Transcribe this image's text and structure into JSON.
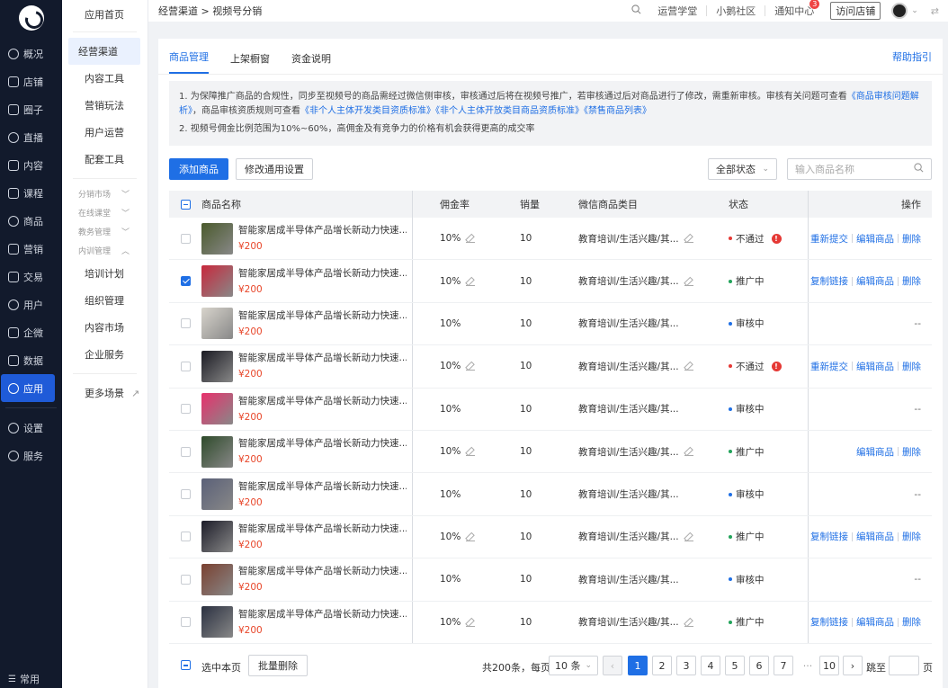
{
  "rail": {
    "items": [
      {
        "label": "概况",
        "icon": "pie-chart-icon"
      },
      {
        "label": "店铺",
        "icon": "store-icon"
      },
      {
        "label": "圈子",
        "icon": "group-icon"
      },
      {
        "label": "直播",
        "icon": "live-icon"
      },
      {
        "label": "内容",
        "icon": "content-icon"
      },
      {
        "label": "课程",
        "icon": "course-icon"
      },
      {
        "label": "商品",
        "icon": "goods-icon"
      },
      {
        "label": "营销",
        "icon": "marketing-icon"
      },
      {
        "label": "交易",
        "icon": "trade-icon"
      },
      {
        "label": "用户",
        "icon": "user-icon"
      },
      {
        "label": "企微",
        "icon": "wecom-icon"
      },
      {
        "label": "数据",
        "icon": "data-icon"
      },
      {
        "label": "应用",
        "icon": "apps-icon"
      }
    ],
    "bottom_items": [
      {
        "label": "设置",
        "icon": "gear-icon"
      },
      {
        "label": "服务",
        "icon": "service-icon"
      }
    ],
    "footer": "常用"
  },
  "menu": {
    "home": "应用首页",
    "items": [
      "经营渠道",
      "内容工具",
      "营销玩法",
      "用户运营",
      "配套工具"
    ],
    "subs": [
      "分销市场",
      "在线课堂",
      "教务管理",
      "内训管理"
    ],
    "items2": [
      "培训计划",
      "组织管理",
      "内容市场",
      "企业服务"
    ],
    "more": "更多场景"
  },
  "topbar": {
    "breadcrumb": "经营渠道 > 视频号分销",
    "links": [
      "运营学堂",
      "小鹅社区",
      "通知中心"
    ],
    "notify_count": "3",
    "visit_store": "访问店铺"
  },
  "tabs": [
    "商品管理",
    "上架橱窗",
    "资金说明"
  ],
  "help": "帮助指引",
  "notice": {
    "line1_a": "1. 为保障推广商品的合规性，同步至视频号的商品需经过微信侧审核，审核通过后将在视频号推广，若审核通过后对商品进行了修改，需重新审核。审核有关问题可查看",
    "line1_link": "《商品审核问题解析》",
    "line1_b": "，商品审核资质规则可查看",
    "line1_links": [
      "《非个人主体开发类目资质标准》",
      "《非个人主体开放类目商品资质标准》",
      "《禁售商品列表》"
    ],
    "line2": "2. 视频号佣金比例范围为10%~60%，高佣金及有竞争力的价格有机会获得更高的成交率"
  },
  "toolbar": {
    "add": "添加商品",
    "modify": "修改通用设置",
    "status_select": "全部状态",
    "search_placeholder": "输入商品名称"
  },
  "table": {
    "headers": [
      "商品名称",
      "佣金率",
      "销量",
      "微信商品类目",
      "状态",
      "操作"
    ],
    "rows": [
      {
        "name": "智能家居成半导体产品增长新动力快速...",
        "price": "¥200",
        "commission": "10%",
        "sales": "10",
        "category": "教育培训/生活兴趣/其...",
        "status": "不通过",
        "ops": [
          "重新提交",
          "编辑商品",
          "删除"
        ],
        "checked": false,
        "edit": true,
        "color": "#4a5a2c"
      },
      {
        "name": "智能家居成半导体产品增长新动力快速...",
        "price": "¥200",
        "commission": "10%",
        "sales": "10",
        "category": "教育培训/生活兴趣/其...",
        "status": "推广中",
        "ops": [
          "复制链接",
          "编辑商品",
          "删除"
        ],
        "checked": true,
        "edit": true,
        "color": "#c8283c"
      },
      {
        "name": "智能家居成半导体产品增长新动力快速...",
        "price": "¥200",
        "commission": "10%",
        "sales": "10",
        "category": "教育培训/生活兴趣/其...",
        "status": "审核中",
        "ops": [
          "--"
        ],
        "checked": false,
        "edit": false,
        "color": "#d8d4cc"
      },
      {
        "name": "智能家居成半导体产品增长新动力快速...",
        "price": "¥200",
        "commission": "10%",
        "sales": "10",
        "category": "教育培训/生活兴趣/其...",
        "status": "不通过",
        "ops": [
          "重新提交",
          "编辑商品",
          "删除"
        ],
        "checked": false,
        "edit": true,
        "color": "#1a1a22"
      },
      {
        "name": "智能家居成半导体产品增长新动力快速...",
        "price": "¥200",
        "commission": "10%",
        "sales": "10",
        "category": "教育培训/生活兴趣/其...",
        "status": "审核中",
        "ops": [
          "--"
        ],
        "checked": false,
        "edit": false,
        "color": "#e8306c"
      },
      {
        "name": "智能家居成半导体产品增长新动力快速...",
        "price": "¥200",
        "commission": "10%",
        "sales": "10",
        "category": "教育培训/生活兴趣/其...",
        "status": "推广中",
        "ops": [
          "编辑商品",
          "删除"
        ],
        "checked": false,
        "edit": true,
        "color": "#2e4a2a"
      },
      {
        "name": "智能家居成半导体产品增长新动力快速...",
        "price": "¥200",
        "commission": "10%",
        "sales": "10",
        "category": "教育培训/生活兴趣/其...",
        "status": "审核中",
        "ops": [
          "--"
        ],
        "checked": false,
        "edit": false,
        "color": "#5a6078"
      },
      {
        "name": "智能家居成半导体产品增长新动力快速...",
        "price": "¥200",
        "commission": "10%",
        "sales": "10",
        "category": "教育培训/生活兴趣/其...",
        "status": "推广中",
        "ops": [
          "复制链接",
          "编辑商品",
          "删除"
        ],
        "checked": false,
        "edit": true,
        "color": "#1c1c28"
      },
      {
        "name": "智能家居成半导体产品增长新动力快速...",
        "price": "¥200",
        "commission": "10%",
        "sales": "10",
        "category": "教育培训/生活兴趣/其...",
        "status": "审核中",
        "ops": [
          "--"
        ],
        "checked": false,
        "edit": false,
        "color": "#7a4030"
      },
      {
        "name": "智能家居成半导体产品增长新动力快速...",
        "price": "¥200",
        "commission": "10%",
        "sales": "10",
        "category": "教育培训/生活兴趣/其...",
        "status": "推广中",
        "ops": [
          "复制链接",
          "编辑商品",
          "删除"
        ],
        "checked": false,
        "edit": true,
        "color": "#2a3040"
      }
    ]
  },
  "status_colors": {
    "不通过": "#e53935",
    "推广中": "#22a35a",
    "审核中": "#1f6fe5"
  },
  "footer": {
    "select_page": "选中本页",
    "batch_delete": "批量删除",
    "total": "共200条，每页",
    "page_size": "10 条",
    "pages": [
      "1",
      "2",
      "3",
      "4",
      "5",
      "6",
      "7",
      "···",
      "10"
    ],
    "jump": "跳至",
    "page_unit": "页"
  }
}
